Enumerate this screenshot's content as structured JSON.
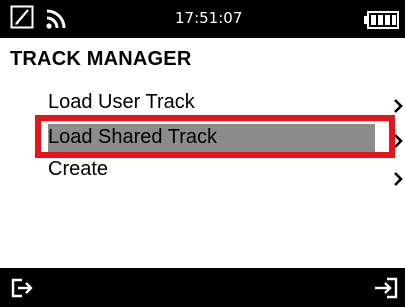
{
  "status_bar": {
    "time": "17:51:07",
    "icons": [
      "edit-icon",
      "wifi-icon",
      "battery-icon"
    ]
  },
  "title": "TRACK MANAGER",
  "menu": {
    "items": [
      {
        "label": "Load User Track",
        "icon": "chevron-right-icon"
      },
      {
        "label": "Load Shared Track",
        "icon": "chevron-right-icon",
        "selected": true
      },
      {
        "label": "Create",
        "icon": "chevron-right-icon"
      }
    ]
  },
  "bottom_bar": {
    "icons": [
      "exit-icon",
      "enter-icon"
    ]
  },
  "colors": {
    "bar_background": "#000000",
    "highlight": "#8c8c8c",
    "selection_outline": "#e8141c"
  }
}
